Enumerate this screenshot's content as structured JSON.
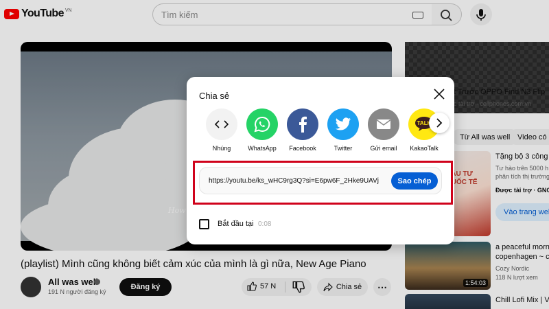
{
  "header": {
    "logo_text": "YouTube",
    "logo_country": "VN",
    "search_placeholder": "Tìm kiếm"
  },
  "video": {
    "watermark": "How",
    "title": "(playlist) Mình cũng không biết cảm xúc của mình là gì nữa, New Age Piano",
    "channel": "All was well",
    "subscribers": "191 N người đăng ký",
    "subscribe_label": "Đăng ký",
    "likes": "57 N",
    "share_label": "Chia sẻ",
    "more_label": "⋯"
  },
  "sidebar": {
    "ad_title": "t Trước OPPO Find N3 Flip",
    "ad_sponsor": "c tài trợ · cellphones.com.vn",
    "chips": [
      "Từ All was well",
      "Video có l"
    ],
    "recommendations": [
      {
        "title": "Tặng bộ 3 công c",
        "lines": [
          "Tư hào trên 5000 h",
          "phân tích thị trường"
        ],
        "sponsor": "Được tài trợ · GNC",
        "button": "Vào trang web",
        "thumb_text": "ĐẦU TƯ\nQUỐC TẾ"
      },
      {
        "title": "a peaceful mornin",
        "title2": "copenhagen ~ cz",
        "channel": "Cozy Nordic",
        "meta": "118 N lượt xem",
        "duration": "1:54:03"
      },
      {
        "title": "Chill Lofi Mix | V"
      }
    ]
  },
  "share_dialog": {
    "title": "Chia sẻ",
    "targets": [
      {
        "label": "Nhúng",
        "icon": "embed-icon",
        "color": "#f2f2f2"
      },
      {
        "label": "WhatsApp",
        "icon": "whatsapp-icon",
        "color": "#25d366"
      },
      {
        "label": "Facebook",
        "icon": "facebook-icon",
        "color": "#3b5998"
      },
      {
        "label": "Twitter",
        "icon": "twitter-icon",
        "color": "#1da1f2"
      },
      {
        "label": "Gửi email",
        "icon": "email-icon",
        "color": "#888888"
      },
      {
        "label": "KakaoTalk",
        "icon": "kakaotalk-icon",
        "color": "#ffe812"
      }
    ],
    "link": "https://youtu.be/ks_wHC9rg3Q?si=E6pw6F_2Hke9UAVj",
    "copy_label": "Sao chép",
    "start_label": "Bắt đầu tại",
    "start_time": "0:08"
  },
  "colors": {
    "brand_red": "#ff0000",
    "accent_blue": "#065fd4",
    "highlight_red": "#d0021b"
  }
}
